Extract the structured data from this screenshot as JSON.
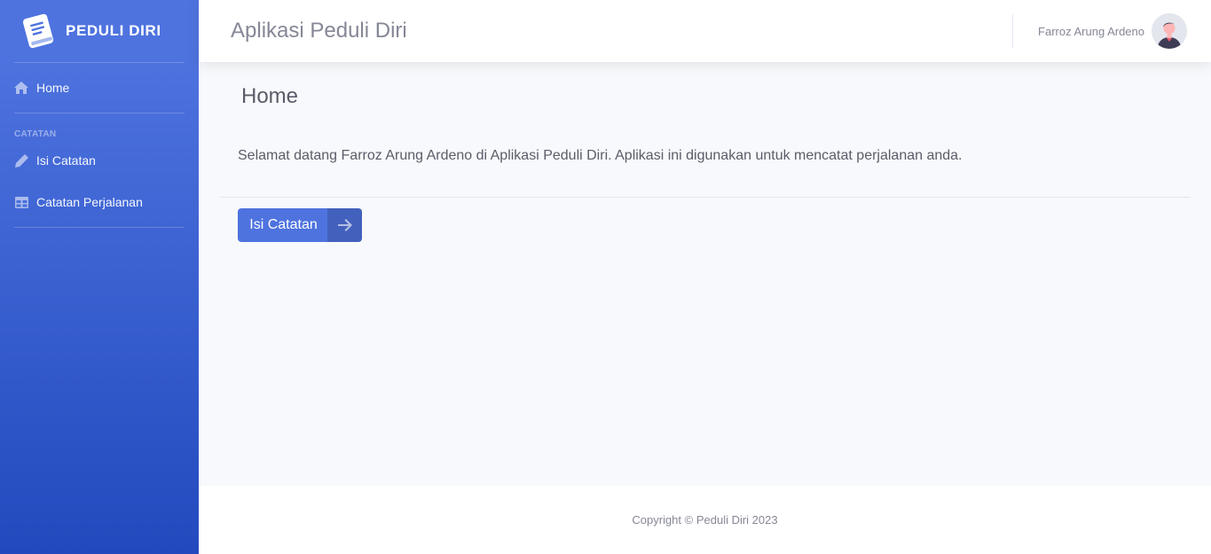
{
  "sidebar": {
    "brand": {
      "text": "PEDULI DIRI",
      "icon": "book-icon"
    },
    "items": [
      {
        "label": "Home",
        "icon": "home-icon"
      },
      {
        "label": "Isi Catatan",
        "icon": "pencil-icon"
      },
      {
        "label": "Catatan Perjalanan",
        "icon": "table-icon"
      }
    ],
    "heading": "CATATAN"
  },
  "topbar": {
    "title": "Aplikasi Peduli Diri",
    "user_name": "Farroz Arung Ardeno",
    "avatar_icon": "user-avatar-icon"
  },
  "main": {
    "page_title": "Home",
    "welcome": "Selamat datang Farroz Arung Ardeno di Aplikasi Peduli Diri. Aplikasi ini digunakan untuk mencatat perjalanan anda.",
    "button_label": "Isi Catatan",
    "button_icon": "arrow-right-icon"
  },
  "footer": {
    "copyright": "Copyright © Peduli Diri 2023"
  },
  "colors": {
    "primary": "#4e73df",
    "primary_dark": "#224abe",
    "text": "#5a5c69",
    "muted": "#858796"
  }
}
